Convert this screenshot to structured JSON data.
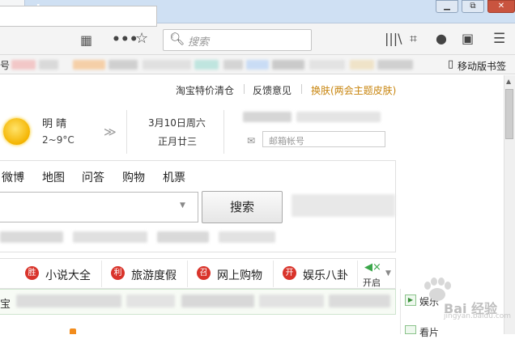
{
  "browser": {
    "tab_close": "✕",
    "new_tab": "+",
    "window_buttons": {
      "minimize": "▁",
      "maximize": "⧉",
      "close": "✕"
    },
    "toolbar": {
      "qr_icon": "qr-code-icon",
      "more": "•••",
      "star": "☆",
      "search_placeholder": "搜索",
      "icons": [
        "library-icon",
        "screenshot-icon",
        "chat-icon",
        "sidebar-icon",
        "menu-icon"
      ]
    },
    "bookmarks": {
      "leading_char": "号",
      "mobile_label": "移动版书签"
    }
  },
  "page": {
    "top_links": {
      "taobao": "淘宝特价清仓",
      "feedback": "反馈意见",
      "skin": "换肤(两会主题皮肤)"
    },
    "weather": {
      "condition": "明 晴",
      "temperature": "2~9°C",
      "arrow": "≫"
    },
    "date": {
      "solar": "3月10日周六",
      "lunar": "正月廿三"
    },
    "mail": {
      "placeholder": "邮箱帐号"
    },
    "nav_tabs": [
      "微博",
      "地图",
      "问答",
      "购物",
      "机票"
    ],
    "search": {
      "button_label": "搜索"
    },
    "categories": [
      {
        "badge": "胜",
        "label": "小说大全"
      },
      {
        "badge": "利",
        "label": "旅游度假"
      },
      {
        "badge": "召",
        "label": "网上购物"
      },
      {
        "badge": "开",
        "label": "娱乐八卦"
      }
    ],
    "speaker_label": "开启",
    "strip_char": "宝",
    "side_panel": {
      "entertainment": "娱乐",
      "watch": "看片"
    },
    "watermark": {
      "text": "Bai 经验",
      "url": "jingyan.baidu.com"
    }
  },
  "colors": {
    "tabstrip": "#cfe0f3",
    "accent_link": "#c8850e",
    "badge_red": "#d9342b",
    "speaker_green": "#3aa64a"
  }
}
